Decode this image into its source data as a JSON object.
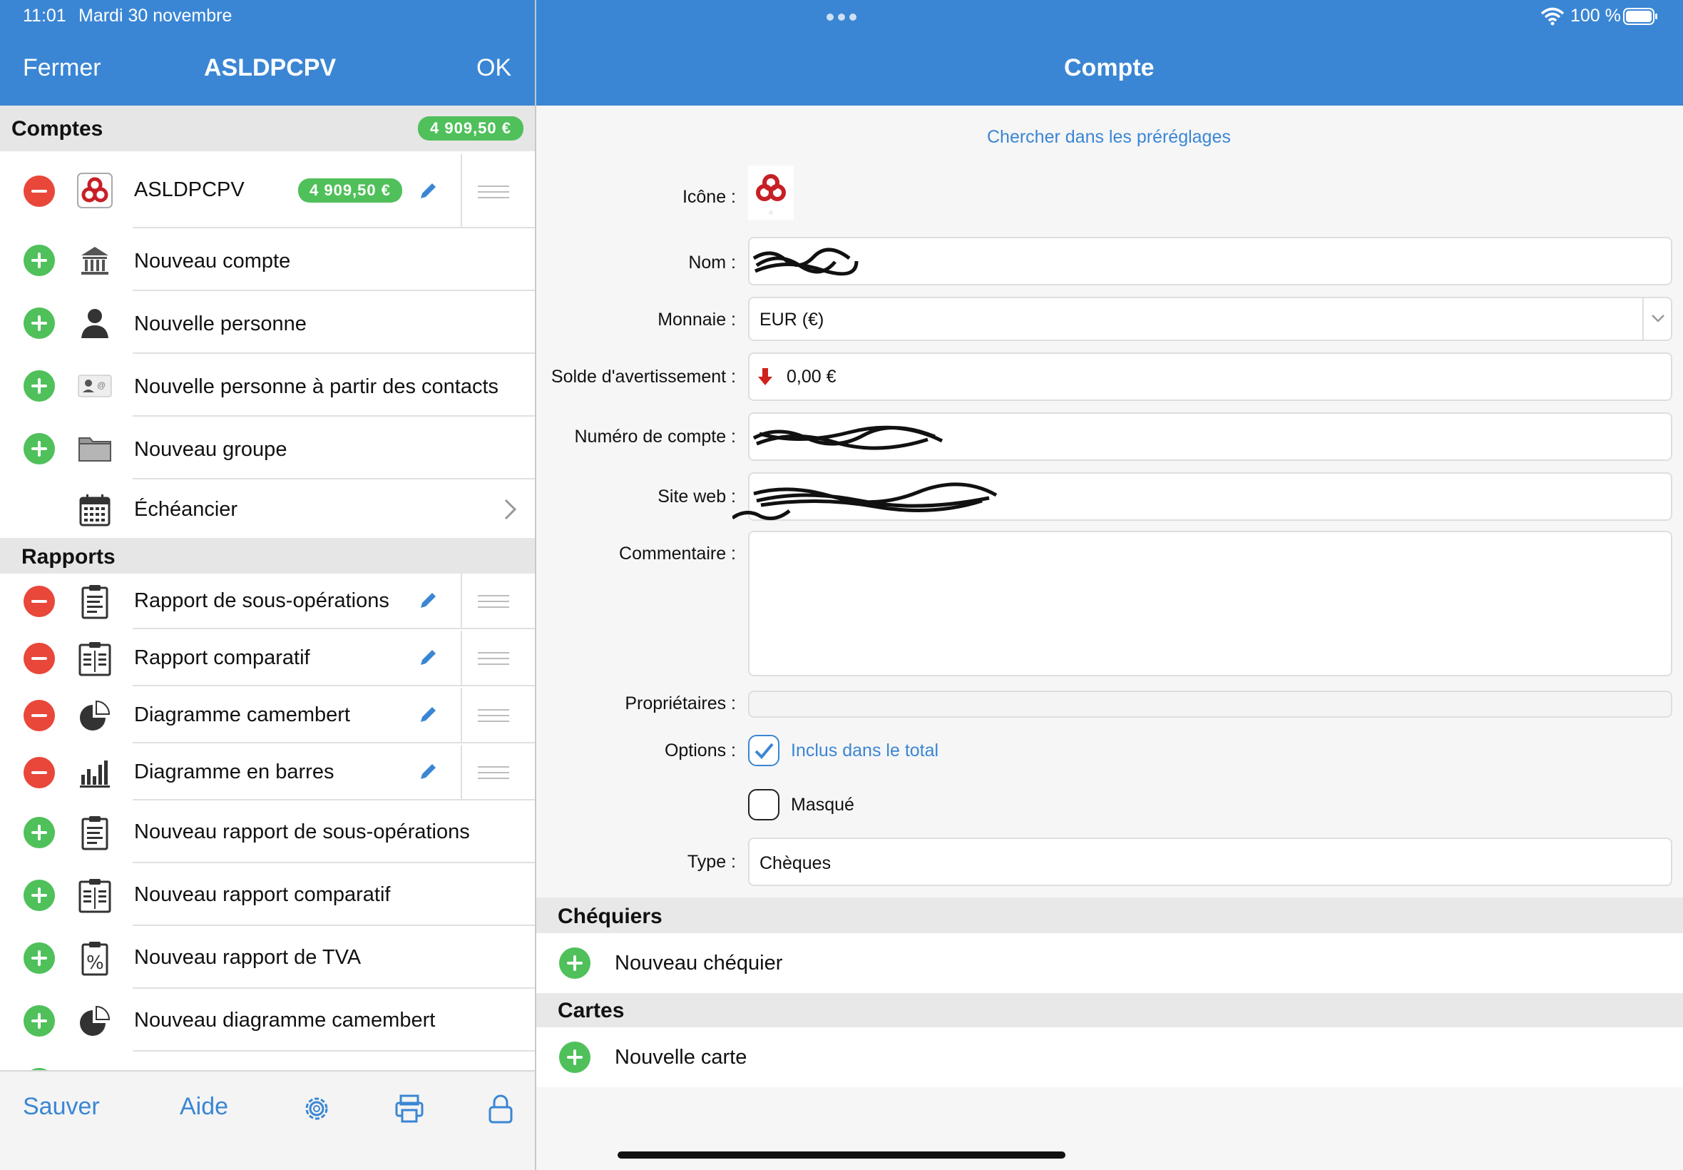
{
  "status": {
    "time": "11:01",
    "date": "Mardi 30 novembre",
    "battery": "100 %"
  },
  "left_nav": {
    "close_label": "Fermer",
    "title": "ASLDPCPV",
    "ok_label": "OK"
  },
  "right_nav": {
    "title": "Compte"
  },
  "accounts_section": {
    "title": "Comptes",
    "total_badge": "4 909,50 €"
  },
  "account_row": {
    "name": "ASLDPCPV",
    "balance": "4 909,50 €"
  },
  "account_actions": [
    {
      "label": "Nouveau compte",
      "icon": "bank-icon"
    },
    {
      "label": "Nouvelle personne",
      "icon": "person-icon"
    },
    {
      "label": "Nouvelle personne à partir des contacts",
      "icon": "contact-card-icon"
    },
    {
      "label": "Nouveau groupe",
      "icon": "folder-icon"
    }
  ],
  "scheduler": {
    "label": "Échéancier",
    "icon": "calendar-icon"
  },
  "reports_section": {
    "title": "Rapports"
  },
  "reports": [
    {
      "label": "Rapport de sous-opérations",
      "icon": "clipboard-list-icon"
    },
    {
      "label": "Rapport comparatif",
      "icon": "clipboard-compare-icon"
    },
    {
      "label": "Diagramme camembert",
      "icon": "pie-chart-icon"
    },
    {
      "label": "Diagramme en barres",
      "icon": "bar-chart-icon"
    }
  ],
  "report_actions": [
    {
      "label": "Nouveau rapport de sous-opérations",
      "icon": "clipboard-list-icon"
    },
    {
      "label": "Nouveau rapport comparatif",
      "icon": "clipboard-compare-icon"
    },
    {
      "label": "Nouveau rapport de TVA",
      "icon": "clipboard-percent-icon"
    },
    {
      "label": "Nouveau diagramme camembert",
      "icon": "pie-chart-icon"
    }
  ],
  "toolbar": {
    "save_label": "Sauver",
    "help_label": "Aide",
    "icons": [
      "gear-icon",
      "print-icon",
      "lock-icon"
    ]
  },
  "form": {
    "preset_link": "Chercher dans les préréglages",
    "icon_label": "Icône :",
    "name_label": "Nom :",
    "currency_label": "Monnaie :",
    "currency_value": "EUR (€)",
    "warning_label": "Solde d'avertissement :",
    "warning_value": "0,00 €",
    "account_number_label": "Numéro de compte :",
    "website_label": "Site web :",
    "comment_label": "Commentaire :",
    "comment_value": "",
    "owners_label": "Propriétaires :",
    "options_label": "Options :",
    "option_included": "Inclus dans le total",
    "option_included_checked": true,
    "option_hidden": "Masqué",
    "option_hidden_checked": false,
    "type_label": "Type :",
    "type_value": "Chèques"
  },
  "checkbooks_section": {
    "title": "Chéquiers",
    "new_label": "Nouveau chéquier"
  },
  "cards_section": {
    "title": "Cartes",
    "new_label": "Nouvelle carte"
  },
  "colors": {
    "accent": "#3a86d4",
    "add": "#4fc05a",
    "remove": "#e8473a"
  }
}
